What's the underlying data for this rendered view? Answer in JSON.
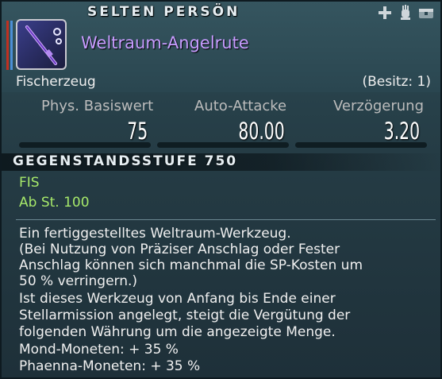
{
  "tooltip": {
    "rarity": "SELTEN PERSÖN",
    "item_name": "Weltraum-Angelrute",
    "category": "Fischerzeug",
    "owned": "(Besitz: 1)",
    "icons": [
      "crest-icon",
      "hand-icon",
      "chest-icon"
    ],
    "stats": [
      {
        "label": "Phys. Basiswert",
        "value": "75"
      },
      {
        "label": "Auto-Attacke",
        "value": "80.00"
      },
      {
        "label": "Verzögerung",
        "value": "3.20"
      }
    ],
    "item_level": "GEGENSTANDSSTUFE 750",
    "job": "FIS",
    "required_level": "Ab St. 100",
    "description": [
      "Ein fertiggestelltes Weltraum-Werkzeug.",
      "(Bei Nutzung von Präziser Anschlag oder Fester",
      "Anschlag können sich manchmal die SP-Kosten um",
      "50 % verringern.)",
      "Ist dieses Werkzeug von Anfang bis Ende einer",
      "Stellarmission angelegt, steigt die Vergütung der",
      "folgenden Währung um die angezeigte Menge.",
      "Mond-Moneten: + 35 %",
      "Phaenna-Moneten: + 35 %"
    ],
    "colors": {
      "item_name": "#c79cff",
      "job": "#a6e86a",
      "background": "#253c45"
    }
  }
}
